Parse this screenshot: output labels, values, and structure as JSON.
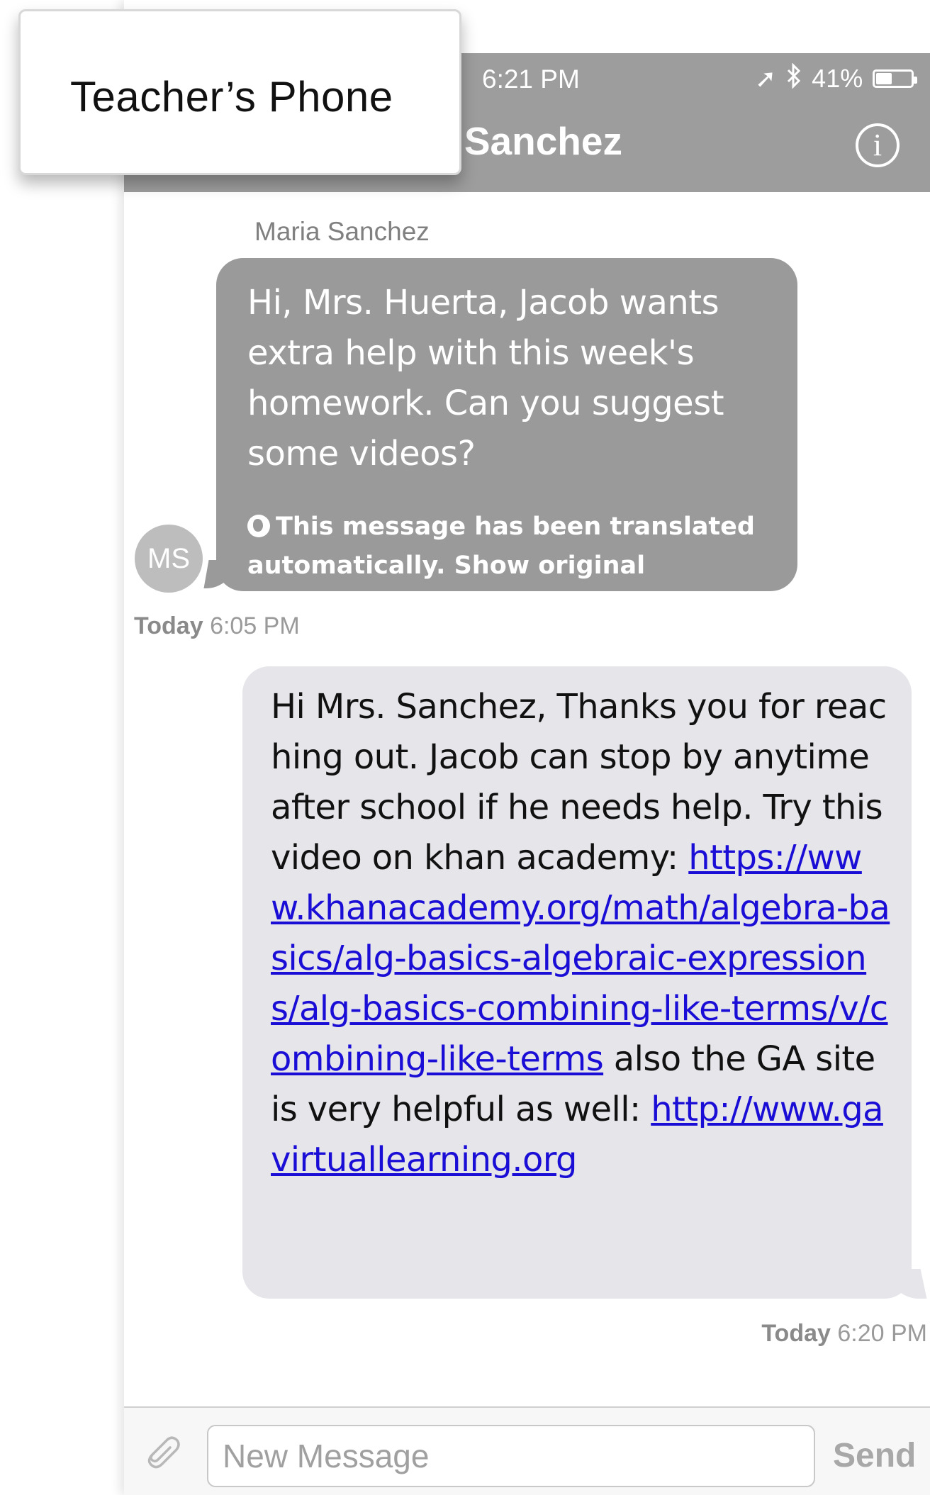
{
  "label": {
    "text": "Teacher’s Phone"
  },
  "status_bar": {
    "time": "6:21 PM",
    "battery": "41%",
    "battery_level": 0.41
  },
  "header": {
    "contact_name": "a Sanchez"
  },
  "messages": {
    "incoming": {
      "sender": "Maria Sanchez",
      "avatar_initials": "MS",
      "text": "Hi, Mrs. Huerta, Jacob wants extra help with this week's homework. Can you suggest some videos?",
      "translation_notice": "This message has been translated automatically. Show original message.",
      "timestamp_day": "Today",
      "timestamp_time": "6:05 PM"
    },
    "outgoing": {
      "text_1": "Hi Mrs. Sanchez, Thanks you for reaching out. Jacob can stop by anytime after school if he needs help. Try this video on khan academy: ",
      "link_1": "https://www.khanacademy.org/math/algebra-basics/alg-basics-algebraic-expressions/alg-basics-combining-like-terms/v/combining-like-terms",
      "text_2": " also the GA site is very helpful as well: ",
      "link_2": "http://www.gavirtuallearning.org",
      "timestamp_day": "Today",
      "timestamp_time": "6:20 PM"
    }
  },
  "composer": {
    "placeholder": "New Message",
    "send_label": "Send"
  },
  "colors": {
    "header": "#9d9d9d",
    "incoming_bubble": "#9a9a9a",
    "outgoing_bubble": "#e5e5ea",
    "link": "#1a0dd6"
  }
}
